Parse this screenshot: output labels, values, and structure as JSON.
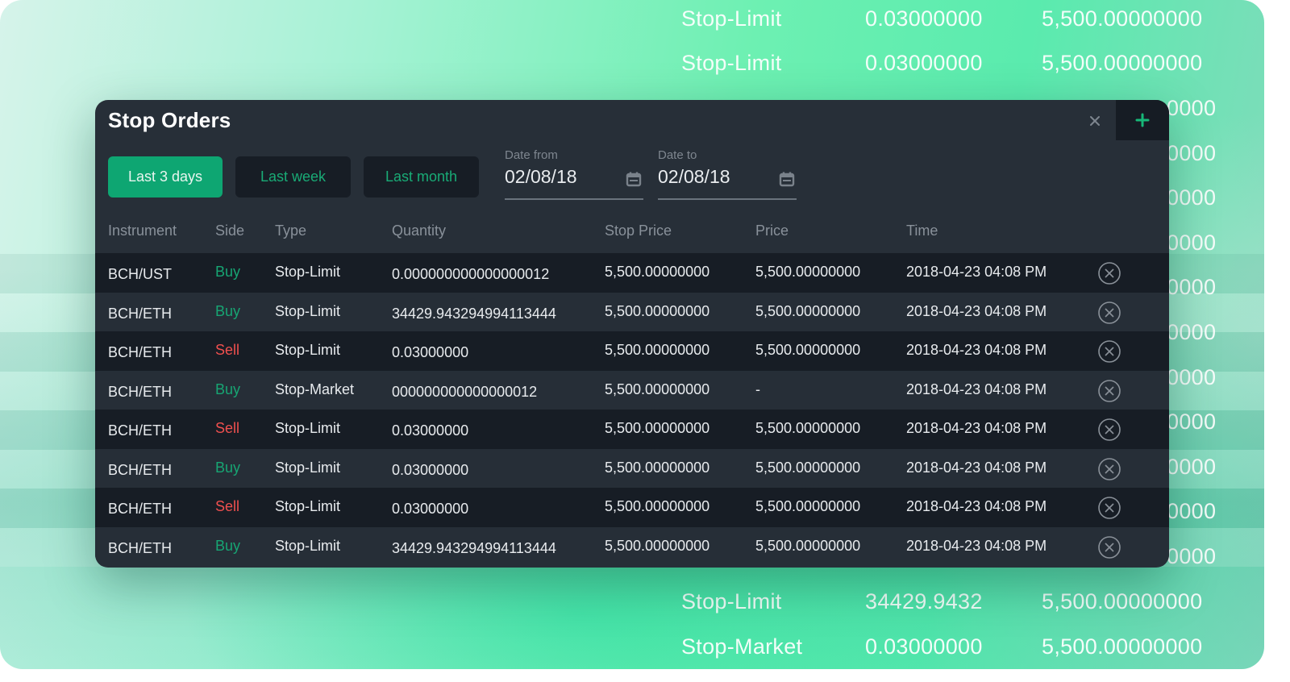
{
  "panel": {
    "title": "Stop Orders",
    "close_icon": "close-icon",
    "add_icon": "plus-icon",
    "accent_color": "#0ea672",
    "buy_color": "#17a573",
    "sell_color": "#f0504f"
  },
  "filters": {
    "buttons": [
      {
        "label": "Last 3 days",
        "active": true
      },
      {
        "label": "Last week",
        "active": false
      },
      {
        "label": "Last month",
        "active": false
      }
    ],
    "date_from": {
      "label": "Date from",
      "value": "02/08/18",
      "icon": "calendar-icon"
    },
    "date_to": {
      "label": "Date to",
      "value": "02/08/18",
      "icon": "calendar-icon"
    }
  },
  "table": {
    "columns": [
      "Instrument",
      "Side",
      "Type",
      "Quantity",
      "Stop Price",
      "Price",
      "Time"
    ],
    "rows": [
      {
        "instrument": "BCH/UST",
        "side": "Buy",
        "type": "Stop-Limit",
        "quantity": "0.000000000000000012",
        "stop_price": "5,500.00000000",
        "price": "5,500.00000000",
        "time": "2018-04-23 04:08 PM"
      },
      {
        "instrument": "BCH/ETH",
        "side": "Buy",
        "type": "Stop-Limit",
        "quantity": "34429.943294994113444",
        "stop_price": "5,500.00000000",
        "price": "5,500.00000000",
        "time": "2018-04-23 04:08 PM"
      },
      {
        "instrument": "BCH/ETH",
        "side": "Sell",
        "type": "Stop-Limit",
        "quantity": "0.03000000",
        "stop_price": "5,500.00000000",
        "price": "5,500.00000000",
        "time": "2018-04-23 04:08 PM"
      },
      {
        "instrument": "BCH/ETH",
        "side": "Buy",
        "type": "Stop-Market",
        "quantity": "000000000000000012",
        "stop_price": "5,500.00000000",
        "price": "-",
        "time": "2018-04-23 04:08 PM"
      },
      {
        "instrument": "BCH/ETH",
        "side": "Sell",
        "type": "Stop-Limit",
        "quantity": "0.03000000",
        "stop_price": "5,500.00000000",
        "price": "5,500.00000000",
        "time": "2018-04-23 04:08 PM"
      },
      {
        "instrument": "BCH/ETH",
        "side": "Buy",
        "type": "Stop-Limit",
        "quantity": "0.03000000",
        "stop_price": "5,500.00000000",
        "price": "5,500.00000000",
        "time": "2018-04-23 04:08 PM"
      },
      {
        "instrument": "BCH/ETH",
        "side": "Sell",
        "type": "Stop-Limit",
        "quantity": "0.03000000",
        "stop_price": "5,500.00000000",
        "price": "5,500.00000000",
        "time": "2018-04-23 04:08 PM"
      },
      {
        "instrument": "BCH/ETH",
        "side": "Buy",
        "type": "Stop-Limit",
        "quantity": "34429.943294994113444",
        "stop_price": "5,500.00000000",
        "price": "5,500.00000000",
        "time": "2018-04-23 04:08 PM"
      }
    ],
    "row_action_icon": "cancel-circle-icon"
  },
  "background": {
    "rows": [
      {
        "type": "Stop-Limit",
        "quantity": "0.03000000",
        "price": "5,500.00000000"
      },
      {
        "type": "Stop-Limit",
        "quantity": "0.03000000",
        "price": "5,500.00000000"
      },
      {
        "type": "",
        "quantity": "",
        "price": "0000"
      },
      {
        "type": "",
        "quantity": "",
        "price": "0000"
      },
      {
        "type": "",
        "quantity": "",
        "price": "0000"
      },
      {
        "type": "",
        "quantity": "",
        "price": "0000"
      },
      {
        "type": "",
        "quantity": "",
        "price": "0000"
      },
      {
        "type": "",
        "quantity": "",
        "price": "0000"
      },
      {
        "type": "",
        "quantity": "",
        "price": "0000"
      },
      {
        "type": "",
        "quantity": "",
        "price": "0000"
      },
      {
        "type": "",
        "quantity": "",
        "price": "0000"
      },
      {
        "type": "",
        "quantity": "",
        "price": "0000"
      },
      {
        "type": "",
        "quantity": "",
        "price": "0000"
      },
      {
        "type": "Stop-Limit",
        "quantity": "34429.9432",
        "price": "5,500.00000000"
      },
      {
        "type": "Stop-Market",
        "quantity": "0.03000000",
        "price": "5,500.00000000"
      }
    ]
  }
}
